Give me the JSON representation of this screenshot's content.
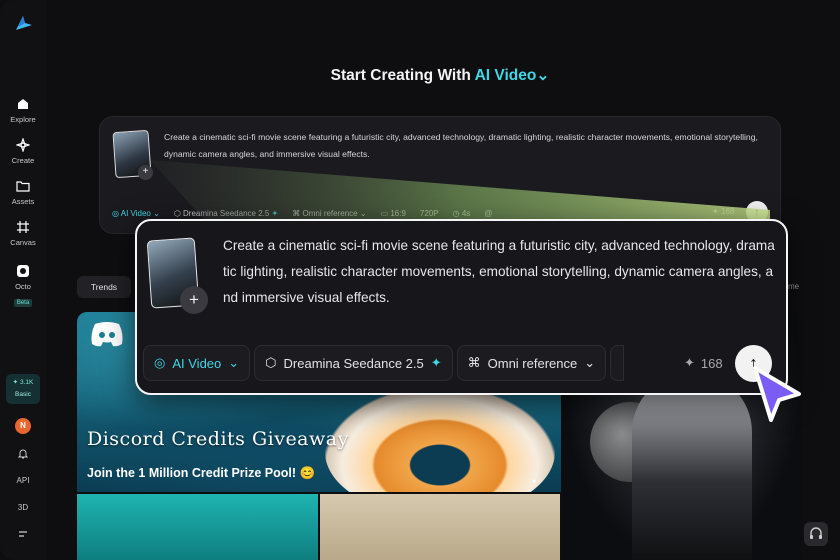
{
  "sidebar": {
    "items": [
      {
        "label": "Explore",
        "icon": "home-icon"
      },
      {
        "label": "Create",
        "icon": "sparkle-icon"
      },
      {
        "label": "Assets",
        "icon": "folder-icon"
      },
      {
        "label": "Canvas",
        "icon": "canvas-icon"
      },
      {
        "label": "Octo",
        "icon": "octo-icon",
        "badge": "Beta"
      }
    ],
    "credits": "3.1K",
    "plan": "Basic",
    "avatar_initial": "N",
    "bottom": [
      "API",
      "3D"
    ]
  },
  "header": {
    "title_prefix": "Start Creating With",
    "title_accent": "AI Video"
  },
  "prompt": {
    "text": "Create a cinematic sci-fi movie scene featuring a futuristic city, advanced technology, dramatic lighting, realistic character movements, emotional storytelling, dynamic camera angles, and immersive visual effects.",
    "mode": "AI Video",
    "model": "Dreamina Seedance 2.5",
    "reference": "Omni reference",
    "ratio": "16:9",
    "resolution": "720P",
    "duration": "4s",
    "credits": "168"
  },
  "tabs": {
    "trends": "Trends",
    "more_partial": "me"
  },
  "gallery": {
    "title": "Discord Credits Giveaway",
    "subtitle": "Join the 1 Million Credit Prize Pool! 😊"
  },
  "colors": {
    "accent": "#3fd6e6",
    "background": "#0e0e10",
    "cursor": "#7b5cf5"
  }
}
